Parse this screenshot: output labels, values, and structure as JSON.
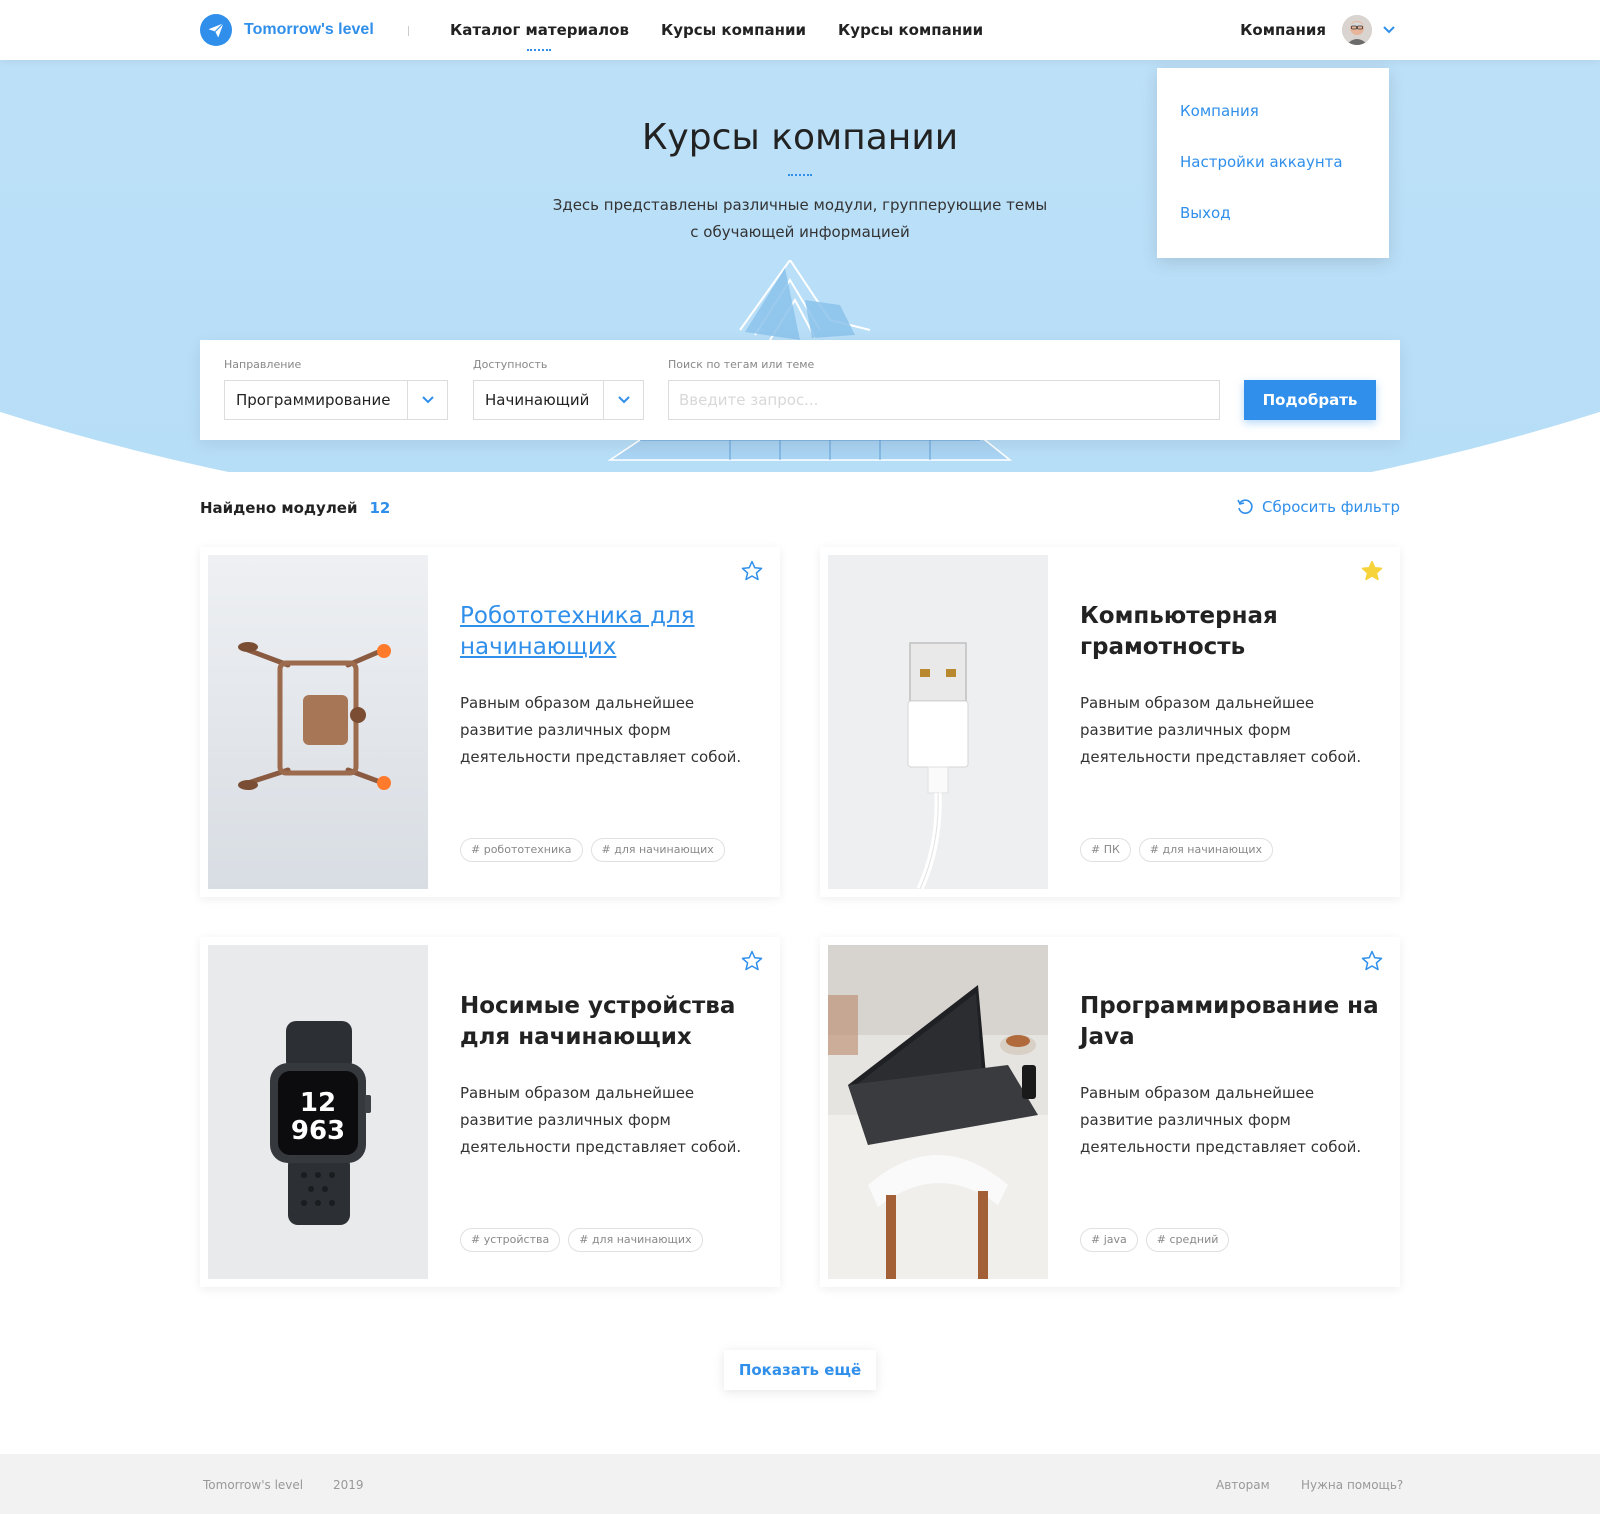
{
  "brand": {
    "name": "Tomorrow's level",
    "accent": "#2f8fea"
  },
  "nav": [
    {
      "label": "Каталог материалов"
    },
    {
      "label": "Курсы компании"
    },
    {
      "label": "Курсы компании"
    }
  ],
  "user": {
    "name": "Компания"
  },
  "user_menu": [
    {
      "label": "Компания"
    },
    {
      "label": "Настройки аккаунта"
    },
    {
      "label": "Выход"
    }
  ],
  "hero": {
    "title": "Курсы компании",
    "subtitle_line1": "Здесь представлены различные модули, групперующие темы",
    "subtitle_line2": "с обучающей информацией"
  },
  "filter": {
    "direction_label": "Направление",
    "direction_value": "Программирование",
    "level_label": "Доступность",
    "level_value": "Начинающий",
    "search_label": "Поиск по тегам или теме",
    "search_placeholder": "Введите запрос...",
    "submit": "Подобрать"
  },
  "results": {
    "found_label": "Найдено модулей",
    "count": "12",
    "reset_label": "Сбросить фильтр"
  },
  "cards": [
    {
      "title": "Робототехника для начинающих",
      "desc": "Равным образом дальнейшее развитие различных форм деятельности представляет собой.",
      "tags": [
        "# робототехника",
        "# для начинающих"
      ],
      "favorite": false,
      "image_icon": "drone-image"
    },
    {
      "title": "Компьютерная грамотность",
      "desc": "Равным образом дальнейшее развитие различных форм деятельности представляет собой.",
      "tags": [
        "# ПК",
        "# для начинающих"
      ],
      "favorite": true,
      "image_icon": "usb-cable-image"
    },
    {
      "title": "Носимые устройства для начинающих",
      "desc": "Равным образом дальнейшее развитие различных форм деятельности представляет собой.",
      "tags": [
        "# устройства",
        "# для начинающих"
      ],
      "favorite": false,
      "image_icon": "smartwatch-image"
    },
    {
      "title": "Программирование на Java",
      "desc": "Равным образом дальнейшее развитие различных форм деятельности представляет собой.",
      "tags": [
        "# java",
        "# средний"
      ],
      "favorite": false,
      "image_icon": "laptop-image"
    }
  ],
  "more_label": "Показать ещё",
  "footer": {
    "brand": "Tomorrow's level",
    "year": "2019",
    "authors": "Авторам",
    "help": "Нужна помощь?"
  }
}
